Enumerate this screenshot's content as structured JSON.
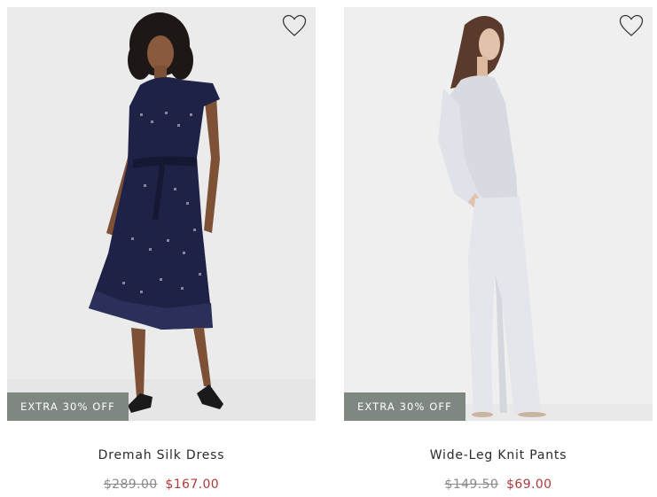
{
  "products": [
    {
      "name": "Dremah Silk Dress",
      "badge": "EXTRA 30% OFF",
      "original_price": "$289.00",
      "sale_price": "$167.00",
      "favorite_icon": "heart-outline-icon"
    },
    {
      "name": "Wide-Leg Knit Pants",
      "badge": "EXTRA 30% OFF",
      "original_price": "$149.50",
      "sale_price": "$69.00",
      "favorite_icon": "heart-outline-icon"
    }
  ],
  "colors": {
    "badge_bg": "#7e8880",
    "sale_price": "#b0393b",
    "original_price": "#8a8a8a",
    "photo_bg": "#ececec"
  }
}
